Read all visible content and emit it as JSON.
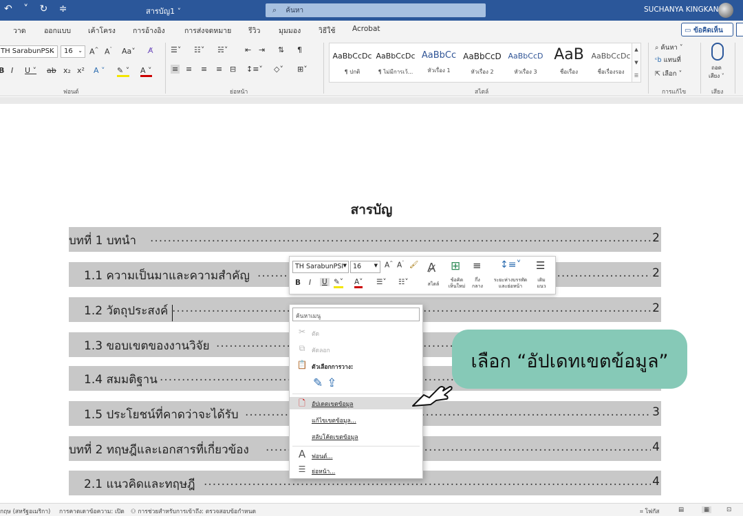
{
  "titlebar": {
    "qat": "↶ ˅ ↻ ≑",
    "doc_title": "สารบัญ1 ˅",
    "search_placeholder": "ค้นหา",
    "user_name": "SUCHANYA KINGKAN"
  },
  "tabs": [
    {
      "label": "วาด"
    },
    {
      "label": "ออกแบบ"
    },
    {
      "label": "เค้าโครง"
    },
    {
      "label": "การอ้างอิง"
    },
    {
      "label": "การส่งจดหมาย"
    },
    {
      "label": "รีวิว"
    },
    {
      "label": "มุมมอง"
    },
    {
      "label": "วิธีใช้"
    },
    {
      "label": "Acrobat"
    }
  ],
  "comment_button": "ข้อคิดเห็น",
  "ribbon": {
    "font_name": "TH SarabunPSK",
    "font_size": "16",
    "groups": {
      "font": "ฟอนต์",
      "paragraph": "ย่อหน้า",
      "styles": "สไตล์",
      "editing": "การแก้ไข",
      "voice": "เสียง"
    },
    "styles": [
      {
        "sample": "AaBbCcDc",
        "name": "¶ ปกติ",
        "color": "#222222"
      },
      {
        "sample": "AaBbCcDc",
        "name": "¶ ไม่มีการเว้...",
        "color": "#222222"
      },
      {
        "sample": "AaBbCc",
        "name": "หัวเรื่อง 1",
        "color": "#2f5496"
      },
      {
        "sample": "AaBbCcD",
        "name": "หัวเรื่อง 2",
        "color": "#222222"
      },
      {
        "sample": "AaBbCcD",
        "name": "หัวเรื่อง 3",
        "color": "#2f5496"
      },
      {
        "sample": "AaB",
        "name": "ชื่อเรื่อง",
        "color": "#222222"
      },
      {
        "sample": "AaBbCcDc",
        "name": "ชื่อเรื่องรอง",
        "color": "#555555"
      }
    ],
    "editing": {
      "find": "ค้นหา",
      "replace": "แทนที่",
      "select": "เลือก"
    },
    "voice": {
      "dictate": "ถอด",
      "dictate2": "เสียง"
    }
  },
  "document": {
    "title": "สารบัญ",
    "toc": [
      {
        "text": "บทที่ 1 บทนำ",
        "page": "2"
      },
      {
        "text": "1.1 ความเป็นมาและความสำคัญ",
        "page": "2"
      },
      {
        "text": "1.2 วัตถุประสงค์",
        "page": "2"
      },
      {
        "text": "1.3 ขอบเขตของงานวิจัย",
        "page": "2"
      },
      {
        "text": "1.4 สมมติฐาน",
        "page": "2"
      },
      {
        "text": "1.5 ประโยชน์ที่คาดว่าจะได้รับ",
        "page": "3"
      },
      {
        "text": "บทที่ 2 ทฤษฎีและเอกสารที่เกี่ยวข้อง",
        "page": "4"
      },
      {
        "text": "2.1 แนวคิดและทฤษฎี",
        "page": "4"
      }
    ]
  },
  "mini_toolbar": {
    "font_name": "TH SarabunPSI",
    "font_size": "16",
    "styles_label": "สไตล์",
    "new_comment_label": "ข้อคิด เห็นใหม่",
    "center_label": "กึ่ง กลาง",
    "spacing_label": "ระยะห่างบรรทัด และย่อหน้า",
    "indent_label": "เติม แนว"
  },
  "context_menu": {
    "search_placeholder": "ค้นหาเมนู",
    "cut": "ตัด",
    "copy": "คัดลอก",
    "paste_options": "ตัวเลือกการวาง:",
    "update_field": "อัปเดตเขตข้อมูล",
    "edit_field": "แก้ไขเขตข้อมูล...",
    "toggle_field": "สลับโค้ดเขตข้อมูล",
    "font": "ฟอนต์...",
    "paragraph": "ย่อหน้า..."
  },
  "callout": {
    "text": "เลือก “อัปเดทเขตข้อมูล”",
    "color": "#86c9b7"
  },
  "statusbar": {
    "language": "กฤษ (สหรัฐอเมริกา)",
    "predictions": "การคาดเดาข้อความ: เปิด",
    "accessibility": "การช่วยสำหรับการเข้าถึง: ตรวจสอบข้อกำหนด",
    "focus": "โฟกัส"
  }
}
